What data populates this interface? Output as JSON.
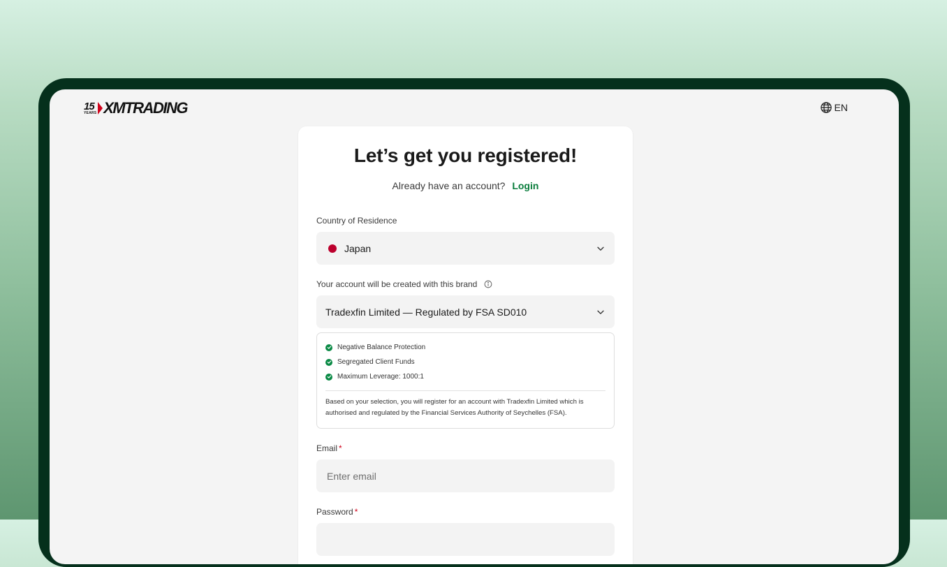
{
  "header": {
    "logo_years": "15",
    "logo_years_label": "YEARS",
    "logo_brand": "XMTRADING",
    "language": "EN"
  },
  "form": {
    "title": "Let’s get you registered!",
    "have_account_text": "Already have an account?",
    "login_label": "Login",
    "country_label": "Country of Residence",
    "country_value": "Japan",
    "brand_label": "Your account will be created with this brand",
    "brand_value": "Tradexfin Limited — Regulated by FSA SD010",
    "features": [
      "Negative Balance Protection",
      "Segregated Client Funds",
      "Maximum Leverage: 1000:1"
    ],
    "regulation_note": "Based on your selection, you will register for an account with Tradexfin Limited which is authorised and regulated by the Financial Services Authority of Seychelles (FSA).",
    "email_label": "Email",
    "email_placeholder": "Enter email",
    "password_label": "Password",
    "required_mark": "*"
  },
  "icons": [
    "globe-icon",
    "chevron-down-icon",
    "info-icon",
    "check-circle-icon",
    "japan-flag-icon"
  ],
  "colors": {
    "accent_green": "#0a7d3c",
    "device_frame": "#05301c",
    "required_red": "#d0021b"
  }
}
